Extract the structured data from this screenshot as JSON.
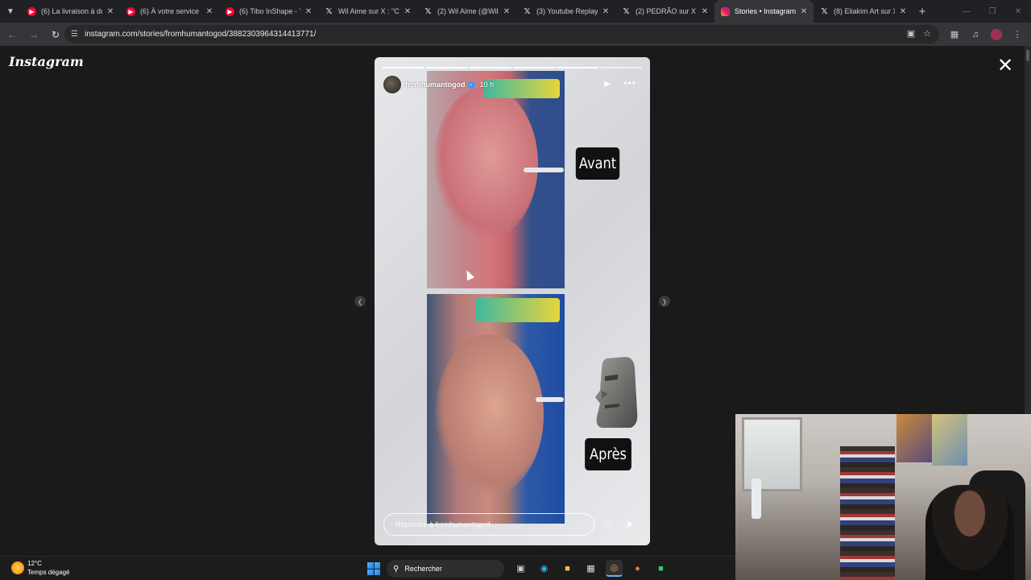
{
  "browser": {
    "tabs": [
      {
        "icon": "youtube",
        "title": "(6) La livraison à dom"
      },
      {
        "icon": "youtube",
        "title": "(6) À votre service | D"
      },
      {
        "icon": "youtube",
        "title": "(6) Tibo InShape - Yo"
      },
      {
        "icon": "x",
        "title": "Wil Aime sur X : \"C'es"
      },
      {
        "icon": "x",
        "title": "(2) Wil Aime (@WilAi"
      },
      {
        "icon": "x",
        "title": "(3) Youtube Replay s"
      },
      {
        "icon": "x",
        "title": "(2) PEDRÃO sur X : \"E"
      },
      {
        "icon": "instagram",
        "title": "Stories • Instagram",
        "active": true
      },
      {
        "icon": "x",
        "title": "(8) Eliakim Art sur X :"
      }
    ],
    "url": "instagram.com/stories/fromhumantogod/3882303964314413771/"
  },
  "instagram": {
    "logo": "Instagram",
    "story": {
      "username": "fromhumantogod",
      "time": "10 h",
      "label_before": "Avant",
      "label_after": "Après",
      "reply_placeholder": "Répondre à fromhumantogod..."
    }
  },
  "taskbar": {
    "temperature": "12°C",
    "weather": "Temps dégagé",
    "search_label": "Rechercher"
  },
  "colors": {
    "ig_verified": "#3897f0",
    "chrome_bg": "#202124",
    "toolbar_bg": "#35363a"
  }
}
